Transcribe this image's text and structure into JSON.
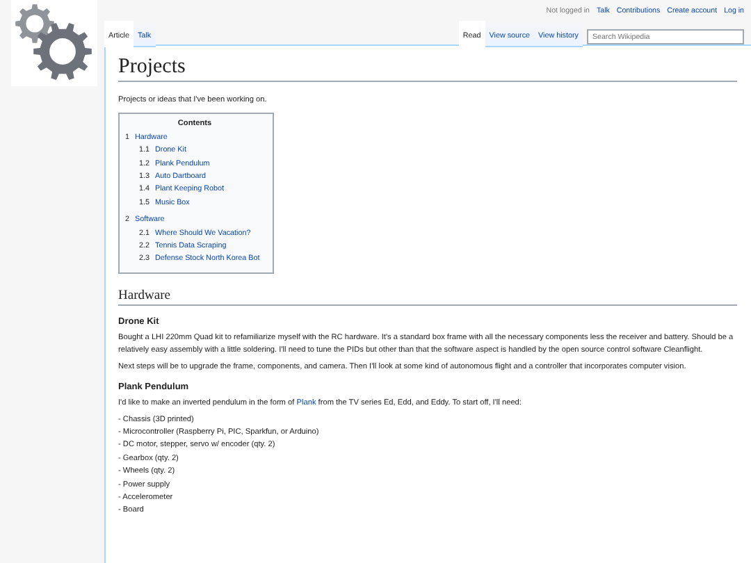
{
  "personal_links": [
    {
      "label": "Not logged in",
      "kind": "status"
    },
    {
      "label": "Talk",
      "kind": "link"
    },
    {
      "label": "Contributions",
      "kind": "link"
    },
    {
      "label": "Create account",
      "kind": "link"
    },
    {
      "label": "Log in",
      "kind": "link"
    }
  ],
  "left_tabs": [
    {
      "label": "Article",
      "selected": true
    },
    {
      "label": "Talk",
      "selected": false
    }
  ],
  "right_tabs": [
    {
      "label": "Read",
      "selected": true
    },
    {
      "label": "View source",
      "selected": false
    },
    {
      "label": "View history",
      "selected": false
    }
  ],
  "search": {
    "placeholder": "Search Wikipedia"
  },
  "title": "Projects",
  "intro": "Projects or ideas that I've been working on.",
  "toc": {
    "title": "Contents",
    "items": [
      {
        "number": "1",
        "label": "Hardware",
        "children": [
          {
            "number": "1.1",
            "label": "Drone Kit"
          },
          {
            "number": "1.2",
            "label": "Plank Pendulum"
          },
          {
            "number": "1.3",
            "label": "Auto Dartboard"
          },
          {
            "number": "1.4",
            "label": "Plant Keeping Robot"
          },
          {
            "number": "1.5",
            "label": "Music Box"
          }
        ]
      },
      {
        "number": "2",
        "label": "Software",
        "children": [
          {
            "number": "2.1",
            "label": "Where Should We Vacation?"
          },
          {
            "number": "2.2",
            "label": "Tennis Data Scraping"
          },
          {
            "number": "2.3",
            "label": "Defense Stock North Korea Bot"
          }
        ]
      }
    ]
  },
  "sections": [
    {
      "heading": "Hardware",
      "subsections": [
        {
          "heading": "Drone Kit",
          "blocks": [
            {
              "kind": "paragraph",
              "segments": [
                {
                  "kind": "text",
                  "text": "Bought a LHI 220mm Quad kit to refamiliarize myself with the RC hardware. It's a standard box frame with all the necessary components less the receiver and battery. Should be a relatively easy assembly with a little soldering. I'll need to tune the PIDs but other than that the software aspect is handled by the open source control software Cleanflight."
                }
              ]
            },
            {
              "kind": "paragraph",
              "segments": [
                {
                  "kind": "text",
                  "text": "Next steps will be to upgrade the frame, components, and camera. Then I'll look at some kind of autonomous flight and a controller that incorporates computer vision."
                }
              ]
            }
          ]
        },
        {
          "heading": "Plank Pendulum",
          "blocks": [
            {
              "kind": "paragraph",
              "segments": [
                {
                  "kind": "text",
                  "text": "I'd like to make an inverted pendulum in the form of "
                },
                {
                  "kind": "link",
                  "text": "Plank"
                },
                {
                  "kind": "text",
                  "text": " from the TV series Ed, Edd, and Eddy. To start off, I'll need:"
                }
              ]
            },
            {
              "kind": "lines",
              "lines": [
                "- Chassis (3D printed)",
                "- Microcontroller (Raspberry Pi, PIC, Sparkfun, or Arduino)",
                "- DC motor, stepper, servo w/ encoder (qty. 2)",
                "- Gearbox (qty. 2)",
                "- Wheels (qty. 2)",
                "- Power supply",
                "- Accelerometer",
                "- Board"
              ]
            }
          ]
        }
      ]
    }
  ]
}
